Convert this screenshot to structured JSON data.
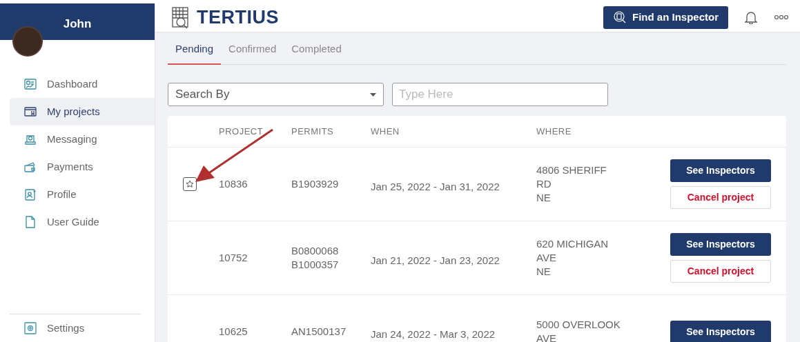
{
  "sidebar": {
    "user_name": "John",
    "items": [
      {
        "label": "Dashboard",
        "selected": false
      },
      {
        "label": "My projects",
        "selected": true
      },
      {
        "label": "Messaging",
        "selected": false
      },
      {
        "label": "Payments",
        "selected": false
      },
      {
        "label": "Profile",
        "selected": false
      },
      {
        "label": "User Guide",
        "selected": false
      }
    ],
    "footer_item": {
      "label": "Settings",
      "selected": false
    }
  },
  "header": {
    "logo_text": "TERTIUS",
    "find_button": "Find an Inspector"
  },
  "tabs": [
    {
      "label": "Pending",
      "selected": true
    },
    {
      "label": "Confirmed",
      "selected": false
    },
    {
      "label": "Completed",
      "selected": false
    }
  ],
  "search": {
    "select_value": "Search By",
    "placeholder": "Type Here"
  },
  "table": {
    "columns": [
      "PROJECT",
      "PERMITS",
      "WHEN",
      "WHERE"
    ],
    "rows": [
      {
        "star_shown": true,
        "project": "10836",
        "permits": [
          "B1903929"
        ],
        "when": "Jan 25, 2022 - Jan 31, 2022",
        "where": [
          "4806 SHERIFF",
          "RD",
          "NE"
        ],
        "actions": [
          {
            "label": "See Inspectors",
            "kind": "primary"
          },
          {
            "label": "Cancel project",
            "kind": "danger"
          }
        ]
      },
      {
        "star_shown": false,
        "project": "10752",
        "permits": [
          "B0800068",
          "B1000357"
        ],
        "when": "Jan 21, 2022 - Jan 23, 2022",
        "where": [
          "620 MICHIGAN",
          "AVE",
          "NE"
        ],
        "actions": [
          {
            "label": "See Inspectors",
            "kind": "primary"
          },
          {
            "label": "Cancel project",
            "kind": "danger"
          }
        ]
      },
      {
        "star_shown": false,
        "project": "10625",
        "permits": [
          "AN1500137"
        ],
        "when": "Jan 24, 2022 - Mar 3, 2022",
        "where": [
          "5000 OVERLOOK",
          "AVE"
        ],
        "actions": [
          {
            "label": "See Inspectors",
            "kind": "primary"
          }
        ]
      }
    ]
  }
}
